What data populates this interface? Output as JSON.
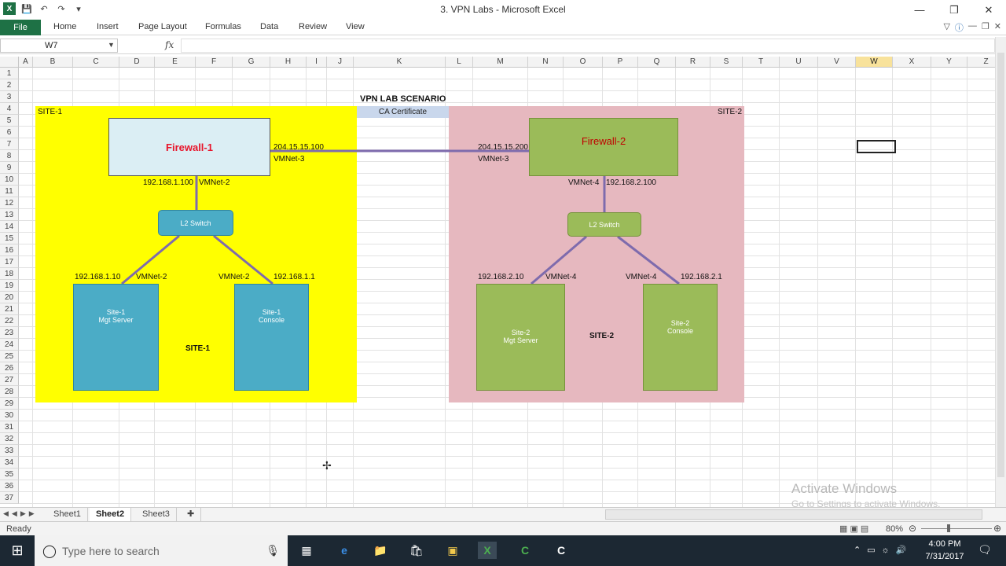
{
  "window": {
    "title": "3. VPN Labs - Microsoft Excel"
  },
  "ribbon": {
    "file": "File",
    "tabs": [
      "Home",
      "Insert",
      "Page Layout",
      "Formulas",
      "Data",
      "Review",
      "View"
    ]
  },
  "formula_bar": {
    "name_box": "W7",
    "fx": "fx",
    "content": ""
  },
  "columns": [
    "A",
    "B",
    "C",
    "D",
    "E",
    "F",
    "G",
    "H",
    "I",
    "J",
    "K",
    "L",
    "M",
    "N",
    "O",
    "P",
    "Q",
    "R",
    "S",
    "T",
    "U",
    "V",
    "W",
    "X",
    "Y",
    "Z"
  ],
  "selected_column": "W",
  "rows": [
    "1",
    "2",
    "3",
    "4",
    "5",
    "6",
    "7",
    "8",
    "9",
    "10",
    "11",
    "12",
    "13",
    "14",
    "15",
    "16",
    "17",
    "18",
    "19",
    "20",
    "21",
    "22",
    "23",
    "24",
    "25",
    "26",
    "27",
    "28",
    "29",
    "30",
    "31",
    "32",
    "33",
    "34",
    "35",
    "36",
    "37"
  ],
  "diagram": {
    "title": "VPN LAB SCENARIO",
    "ca_label": "CA Certificate",
    "site1": {
      "tag": "SITE-1",
      "label": "SITE-1",
      "color": "#ffff00",
      "firewall": "Firewall-1",
      "fw_ext_ip": "204.15.15.100",
      "fw_ext_net": "VMNet-3",
      "fw_int_ip": "192.168.1.100",
      "fw_int_net": "VMNet-2",
      "switch": "L2 Switch",
      "mgt_ip": "192.168.1.10",
      "mgt_net": "VMNet-2",
      "mgt_line1": "Site-1",
      "mgt_line2": "Mgt Server",
      "con_net": "VMNet-2",
      "con_ip": "192.168.1.1",
      "con_line1": "Site-1",
      "con_line2": "Console"
    },
    "site2": {
      "tag": "SITE-2",
      "label": "SITE-2",
      "color": "#e6b8bf",
      "firewall": "Firewall-2",
      "fw_ext_ip": "204.15.15.200",
      "fw_ext_net": "VMNet-3",
      "fw_int_net": "VMNet-4",
      "fw_int_ip": "192.168.2.100",
      "switch": "L2 Switch",
      "mgt_ip": "192.168.2.10",
      "mgt_net": "VMNet-4",
      "mgt_line1": "Site-2",
      "mgt_line2": "Mgt Server",
      "con_net": "VMNet-4",
      "con_ip": "192.168.2.1",
      "con_line1": "Site-2",
      "con_line2": "Console"
    }
  },
  "sheets": [
    "Sheet1",
    "Sheet2",
    "Sheet3"
  ],
  "active_sheet": "Sheet2",
  "status": {
    "ready": "Ready",
    "zoom": "80%"
  },
  "watermark": {
    "line1": "Activate Windows",
    "line2": "Go to Settings to activate Windows."
  },
  "taskbar": {
    "search_placeholder": "Type here to search",
    "time": "4:00 PM",
    "date": "7/31/2017"
  }
}
